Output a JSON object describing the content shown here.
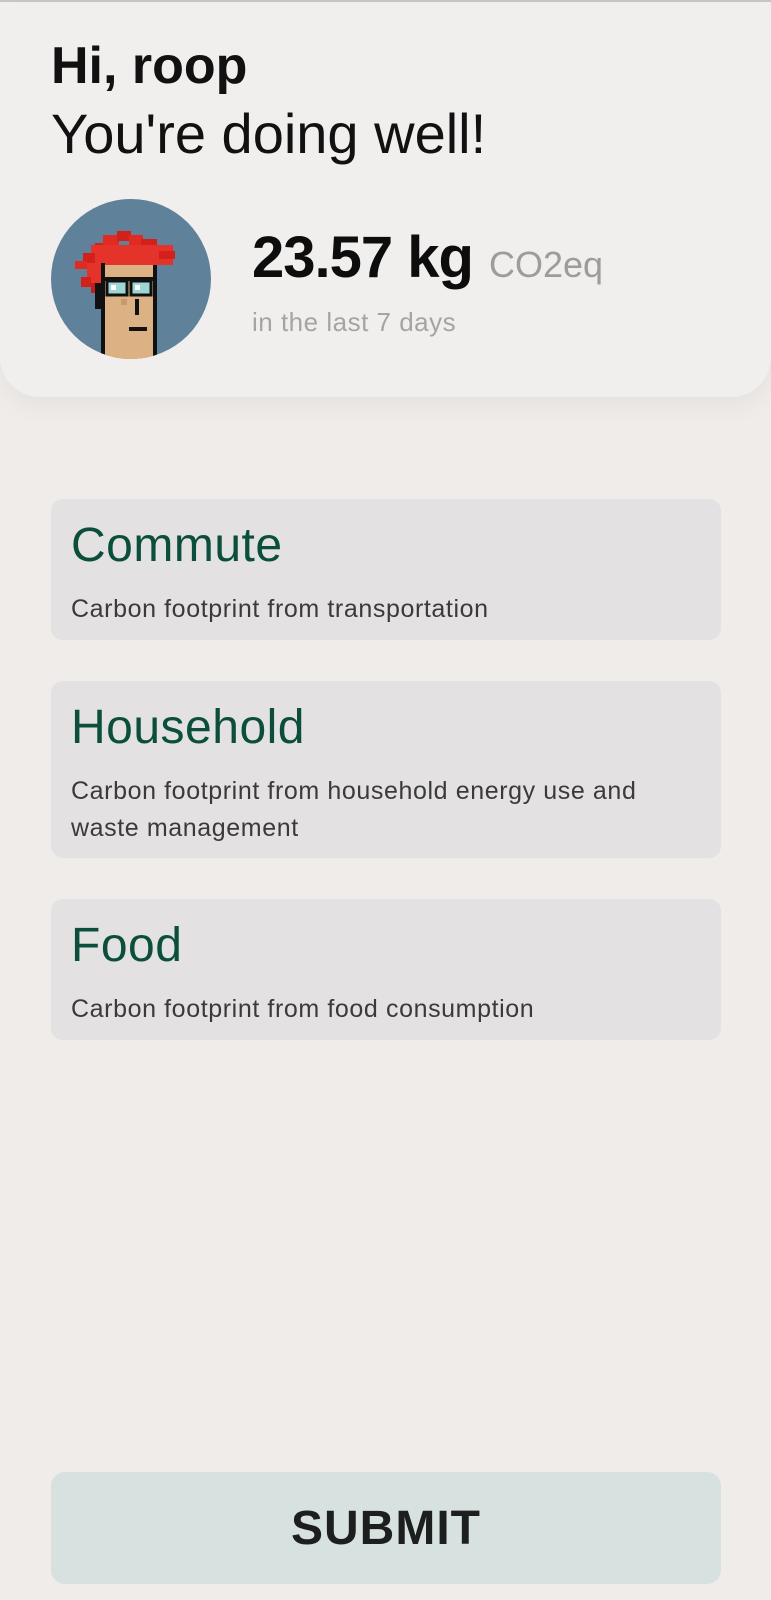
{
  "header": {
    "greeting": "Hi, roop",
    "subgreeting": "You're doing well!",
    "avatar_icon": "pixel-avatar-icon",
    "stat": {
      "value": "23.57 kg",
      "unit": "CO2eq",
      "caption": "in the last 7 days"
    }
  },
  "categories": [
    {
      "title": "Commute",
      "description": "Carbon footprint from transportation"
    },
    {
      "title": "Household",
      "description": "Carbon footprint from household energy use and waste management"
    },
    {
      "title": "Food",
      "description": "Carbon footprint from food consumption"
    }
  ],
  "submit_label": "SUBMIT",
  "colors": {
    "background": "#efecea",
    "card": "#e3e1e1",
    "category_title": "#0b4e3c",
    "avatar_bg": "#5f829a",
    "submit_bg": "#d7e1df"
  }
}
